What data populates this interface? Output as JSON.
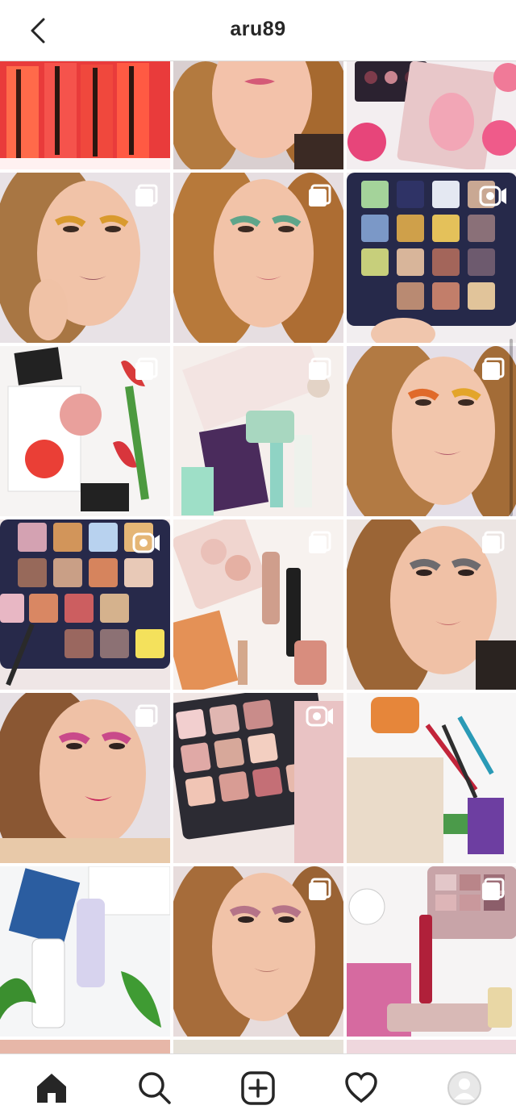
{
  "header": {
    "username": "aru89",
    "back_icon": "chevron-left-icon"
  },
  "colors": {
    "text": "#262626",
    "divider": "#dbdbdb",
    "background": "#ffffff"
  },
  "grid": {
    "columns": 3,
    "posts": [
      {
        "kind": "lipsticks-red-box",
        "badge": "none"
      },
      {
        "kind": "face-closeup",
        "badge": "none"
      },
      {
        "kind": "palette-peonies",
        "badge": "none"
      },
      {
        "kind": "portrait-golden-eyeshadow",
        "badge": "carousel"
      },
      {
        "kind": "portrait-green-eyeshadow",
        "badge": "carousel"
      },
      {
        "kind": "eyeshadow-palette-navy",
        "badge": "video"
      },
      {
        "kind": "blush-tulips-flatlay",
        "badge": "carousel"
      },
      {
        "kind": "abiby-masks-flatlay",
        "badge": "carousel"
      },
      {
        "kind": "portrait-pink-eyeshadow",
        "badge": "carousel"
      },
      {
        "kind": "eyeshadow-palette-hand",
        "badge": "video"
      },
      {
        "kind": "by-terry-flatlay",
        "badge": "carousel"
      },
      {
        "kind": "portrait-smoky-eye",
        "badge": "carousel"
      },
      {
        "kind": "portrait-magenta-lips",
        "badge": "carousel"
      },
      {
        "kind": "pink-palette-hand",
        "badge": "video"
      },
      {
        "kind": "loreal-elvive-flatlay",
        "badge": "none"
      },
      {
        "kind": "skincare-keyboard-flatlay",
        "badge": "none"
      },
      {
        "kind": "portrait-nude-lips",
        "badge": "carousel"
      },
      {
        "kind": "essence-flatlay",
        "badge": "carousel"
      }
    ]
  },
  "bottom_nav": {
    "items": [
      "home-icon",
      "search-icon",
      "new-post-icon",
      "activity-heart-icon",
      "profile-avatar"
    ]
  }
}
